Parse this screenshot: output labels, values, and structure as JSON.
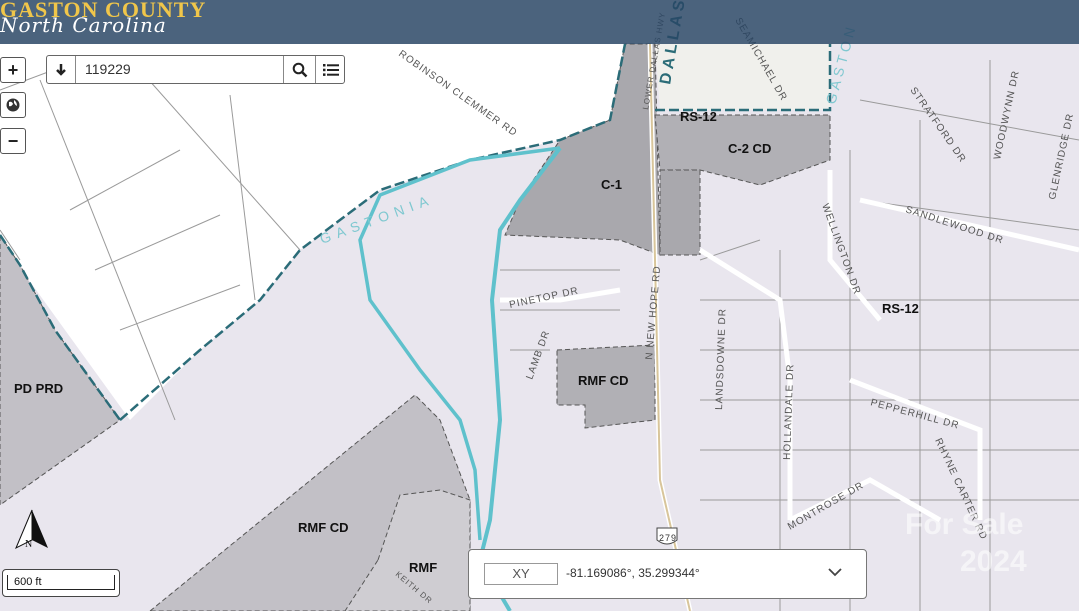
{
  "header": {
    "brand_line1": "GASTON COUNTY",
    "brand_line2": "North Carolina"
  },
  "controls": {
    "zoom_in": "+",
    "zoom_out": "−"
  },
  "search": {
    "value": "119229"
  },
  "scale": {
    "label": "600 ft"
  },
  "coords": {
    "button": "XY",
    "value": "-81.169086°, 35.299344°"
  },
  "north": {
    "label": "N"
  },
  "zones": {
    "rs12_top": "RS-12",
    "c2cd": "C-2 CD",
    "c1": "C-1",
    "rs12_right": "RS-12",
    "pdprd": "PD PRD",
    "rmfcd_mid": "RMF CD",
    "rmfcd_low": "RMF CD",
    "rmf": "RMF"
  },
  "places": {
    "gastonia": "GASTONIA",
    "dallas": "DALLAS",
    "gaston": "GASTON"
  },
  "streets": {
    "robinson_clemmer": "ROBINSON CLEMMER RD",
    "lower_dallas": "LOWER DALLAS HWY",
    "seamichael": "SEAMICHAEL DR",
    "pinetop": "PINETOP DR",
    "lamb": "LAMB DR",
    "new_hope": "N NEW HOPE RD",
    "landsdowne": "LANDSDOWNE DR",
    "hollandale": "HOLLANDALE DR",
    "wellington": "WELLINGTON DR",
    "sandlewood": "SANDLEWOOD DR",
    "stratford": "STRATFORD DR",
    "woodwynn": "WOODWYNN DR",
    "glenridge": "GLENRIDGE DR",
    "pepperhill": "PEPPERHILL DR",
    "montrose": "MONTROSE DR",
    "rhyne_carter": "RHYNE CARTER RD",
    "keith": "KEITH DR",
    "route": "279"
  },
  "watermark": {
    "line1": "For Sale",
    "line2": "2024"
  },
  "colors": {
    "zone_dark": "#a9a8ad",
    "zone_mid": "#c2c0c6",
    "limits": "#2b6c78",
    "river": "#5fc1cc",
    "background": "#e9e6ee"
  }
}
